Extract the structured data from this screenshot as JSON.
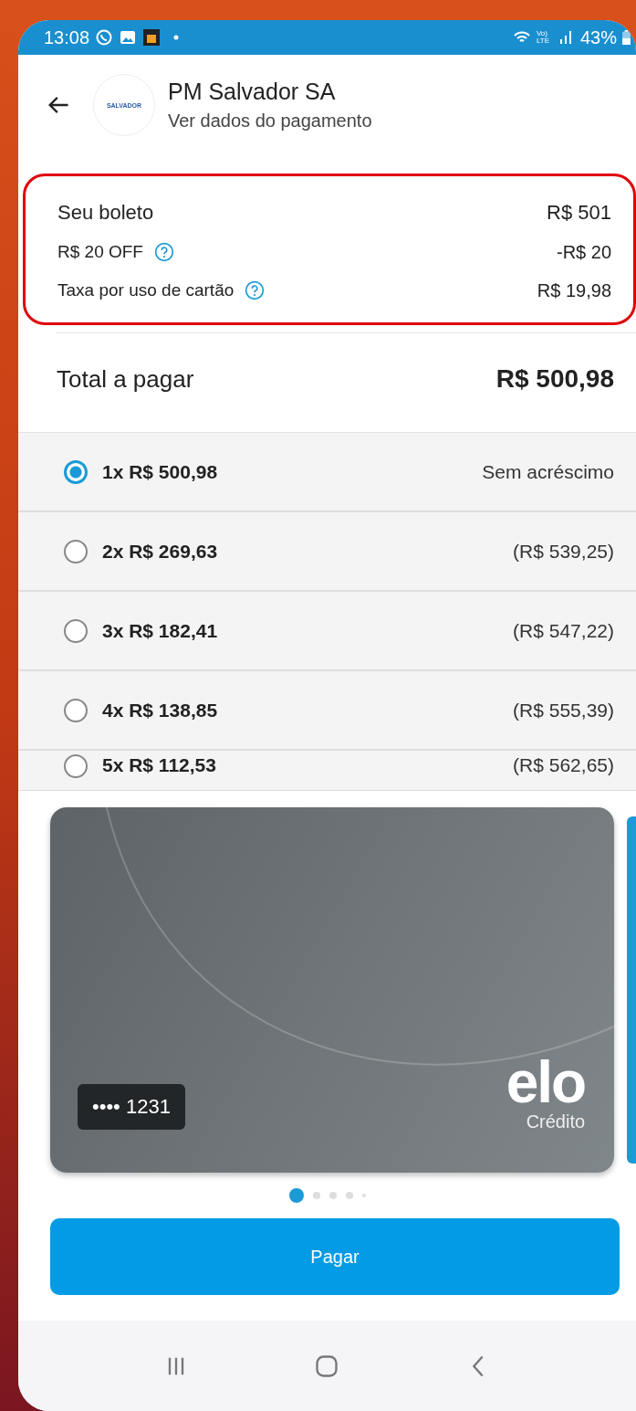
{
  "status_bar": {
    "time": "13:08",
    "battery": "43%",
    "network": "Vo) LTE"
  },
  "header": {
    "logo_text": "SALVADOR",
    "title": "PM Salvador SA",
    "subtitle": "Ver dados do pagamento"
  },
  "summary": [
    {
      "label": "Seu boleto",
      "value": "R$ 501",
      "help": false
    },
    {
      "label": "R$ 20 OFF",
      "value": "-R$ 20",
      "help": true
    },
    {
      "label": "Taxa por uso de cartão",
      "value": "R$ 19,98",
      "help": true
    }
  ],
  "total": {
    "label": "Total a pagar",
    "value": "R$ 500,98"
  },
  "installments": [
    {
      "label": "1x R$ 500,98",
      "note": "Sem acréscimo",
      "selected": true
    },
    {
      "label": "2x R$ 269,63",
      "note": "(R$ 539,25)",
      "selected": false
    },
    {
      "label": "3x R$ 182,41",
      "note": "(R$ 547,22)",
      "selected": false
    },
    {
      "label": "4x R$ 138,85",
      "note": "(R$ 555,39)",
      "selected": false
    },
    {
      "label": "5x R$ 112,53",
      "note": "(R$ 562,65)",
      "selected": false
    }
  ],
  "card": {
    "number": "•••• 1231",
    "brand": "elo",
    "type": "Crédito"
  },
  "pager": [
    {
      "selected": true
    },
    {
      "selected": false
    },
    {
      "selected": false
    },
    {
      "selected": false
    },
    {
      "selected": false
    }
  ],
  "pay_button": "Pagar"
}
